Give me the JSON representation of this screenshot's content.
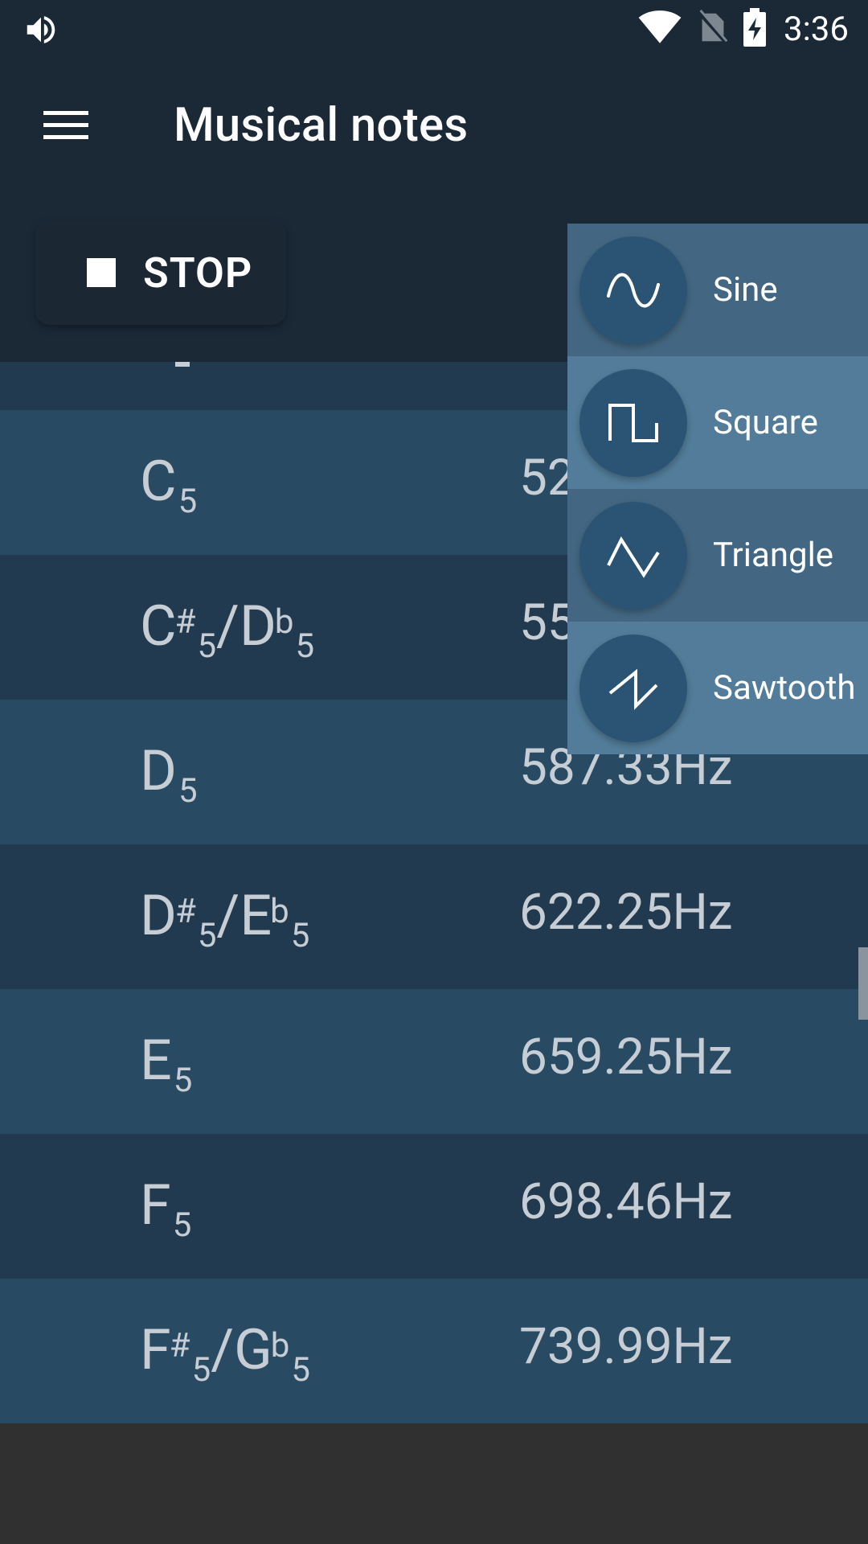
{
  "status_bar": {
    "time": "3:36",
    "icons": [
      "volume-icon",
      "wifi-icon",
      "no-sim-icon",
      "battery-charging-icon"
    ]
  },
  "app_bar": {
    "title": "Musical notes",
    "menu_icon": "hamburger-menu-icon"
  },
  "player": {
    "stop_label": "STOP",
    "stop_icon": "stop-icon"
  },
  "notes": [
    {
      "base": "C",
      "octave": "5",
      "freq": "52"
    },
    {
      "base": "C",
      "octave": "5",
      "sharp": "#",
      "alt_base": "D",
      "flat": "b",
      "alt_octave": "5",
      "freq": "55"
    },
    {
      "base": "D",
      "octave": "5",
      "freq": "587.33Hz"
    },
    {
      "base": "D",
      "octave": "5",
      "sharp": "#",
      "alt_base": "E",
      "flat": "b",
      "alt_octave": "5",
      "freq": "622.25Hz"
    },
    {
      "base": "E",
      "octave": "5",
      "freq": "659.25Hz"
    },
    {
      "base": "F",
      "octave": "5",
      "freq": "698.46Hz"
    },
    {
      "base": "F",
      "octave": "5",
      "sharp": "#",
      "alt_base": "G",
      "flat": "b",
      "alt_octave": "5",
      "freq": "739.99Hz"
    }
  ],
  "waveforms": [
    {
      "label": "Sine",
      "icon": "sine-wave-icon"
    },
    {
      "label": "Square",
      "icon": "square-wave-icon"
    },
    {
      "label": "Triangle",
      "icon": "triangle-wave-icon"
    },
    {
      "label": "Sawtooth",
      "icon": "sawtooth-wave-icon"
    }
  ],
  "colors": {
    "background": "#1b2937",
    "row_light": "#294a63",
    "row_dark": "#223a50",
    "popup_dark": "#436782",
    "popup_light": "#527c99",
    "text": "#c6cdd4"
  }
}
